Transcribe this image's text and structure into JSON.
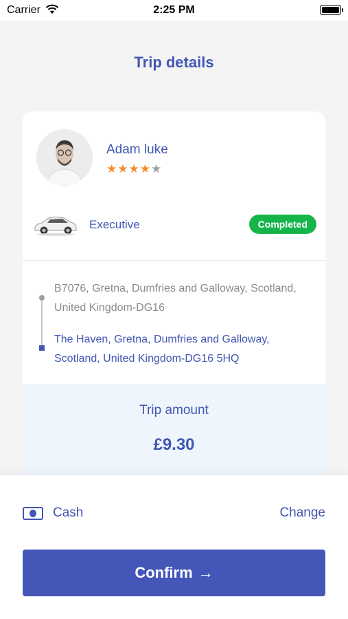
{
  "status_bar": {
    "carrier": "Carrier",
    "time": "2:25 PM"
  },
  "header": {
    "title": "Trip details"
  },
  "driver": {
    "name": "Adam luke",
    "rating": 4.5,
    "rating_stars": "★★★★",
    "rating_half_star": "★"
  },
  "vehicle": {
    "type": "Executive",
    "icon": "car-icon"
  },
  "trip": {
    "status": "Completed",
    "status_color": "#16b54a",
    "pickup": "B7076, Gretna, Dumfries and Galloway, Scotland, United Kingdom-DG16",
    "dropoff": "The Haven, Gretna, Dumfries and Galloway, Scotland, United Kingdom-DG16 5HQ"
  },
  "amount": {
    "label": "Trip amount",
    "value": "£9.30"
  },
  "payment": {
    "method": "Cash",
    "method_icon": "cash-icon",
    "change_label": "Change"
  },
  "actions": {
    "confirm_label": "Confirm",
    "confirm_arrow": "→"
  },
  "colors": {
    "accent": "#4256b2",
    "button": "#4456b8",
    "star": "#f28c28",
    "amount_bg": "#eef5fd"
  }
}
